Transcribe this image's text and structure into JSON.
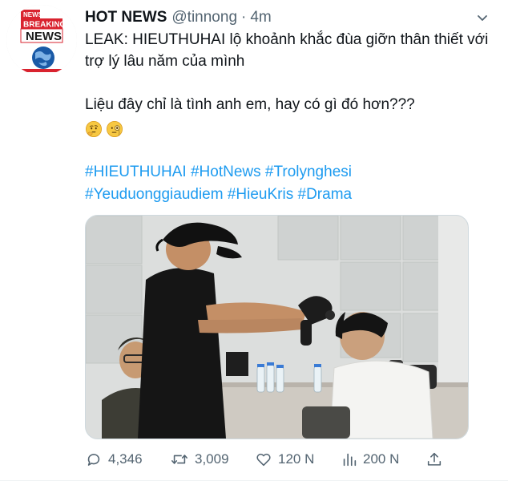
{
  "tweet": {
    "display_name": "HOT NEWS",
    "handle": "@tinnong",
    "separator": "·",
    "time": "4m",
    "text_line1": "LEAK: HIEUTHUHAI lộ khoảnh khắc đùa giỡn thân thiết với trợ lý lâu năm của mình",
    "text_line2": "Liệu đây chỉ là tình anh em, hay có gì đó hơn???",
    "emojis": [
      "thinking-face",
      "monocle-face"
    ],
    "hashtags": [
      "#HIEUTHUHAI",
      "#HotNews",
      "#Trolynghesi",
      "#Yeuduonggiaudiem",
      "#HieuKris",
      "#Drama"
    ]
  },
  "avatar": {
    "small_label": "NEWS",
    "line1": "BREAKING",
    "line2": "NEWS"
  },
  "actions": {
    "replies": "4,346",
    "retweets": "3,009",
    "likes": "120 N",
    "views": "200 N"
  },
  "colors": {
    "link": "#1d9bf0",
    "muted": "#536471",
    "text": "#0f1419",
    "avatar_red": "#d9232f",
    "avatar_blue": "#1a5aa6"
  }
}
